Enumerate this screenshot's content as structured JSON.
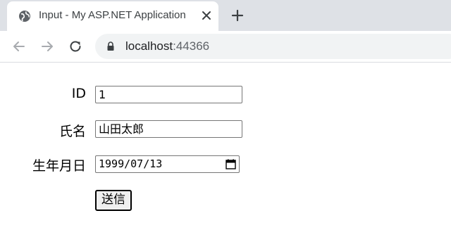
{
  "browser": {
    "tab_title": "Input - My ASP.NET Application",
    "url_host": "localhost",
    "url_port": ":44366",
    "icons": {
      "favicon": "globe-icon",
      "tab_close": "close-icon",
      "new_tab": "plus-icon",
      "back": "back-arrow-icon",
      "forward": "forward-arrow-icon",
      "reload": "reload-icon",
      "lock": "lock-icon"
    }
  },
  "form": {
    "id_label": "ID",
    "id_value": "1",
    "name_label": "氏名",
    "name_value": "山田太郎",
    "birthdate_label": "生年月日",
    "birthdate_value": "1999/07/13",
    "submit_label": "送信",
    "icons": {
      "calendar": "calendar-icon"
    }
  }
}
